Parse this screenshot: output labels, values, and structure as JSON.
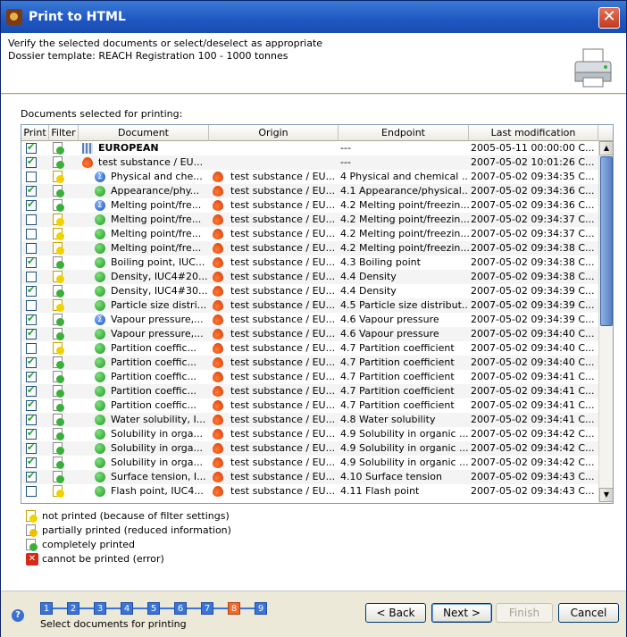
{
  "window": {
    "title": "Print to HTML"
  },
  "header": {
    "line1": "Verify the selected documents or select/deselect as appropriate",
    "line2": "Dossier template: REACH Registration 100 - 1000 tonnes"
  },
  "section_label": "Documents selected for printing:",
  "columns": [
    "Print",
    "Filter",
    "Document",
    "Origin",
    "Endpoint",
    "Last modification"
  ],
  "rows": [
    {
      "print": true,
      "filter": "complete",
      "icon": "grid",
      "document": "EUROPEAN",
      "origin": "",
      "origin_icon": false,
      "endpoint": "---",
      "modified": "2005-05-11 00:00:00 C...",
      "bold": true,
      "indent": 0
    },
    {
      "print": true,
      "filter": "complete",
      "icon": "flask",
      "document": "test substance / EU...",
      "origin": "",
      "origin_icon": false,
      "endpoint": "---",
      "modified": "2007-05-02 10:01:26 C...",
      "indent": 1
    },
    {
      "print": false,
      "filter": "notprinted",
      "icon": "sum",
      "document": "Physical and che...",
      "origin": "test substance / EU...",
      "origin_icon": true,
      "endpoint": "4 Physical and chemical ...",
      "modified": "2007-05-02 09:34:35 C...",
      "indent": 2
    },
    {
      "print": true,
      "filter": "complete",
      "icon": "green",
      "document": "Appearance/phy...",
      "origin": "test substance / EU...",
      "origin_icon": true,
      "endpoint": "4.1 Appearance/physical...",
      "modified": "2007-05-02 09:34:36 C...",
      "indent": 2
    },
    {
      "print": true,
      "filter": "complete",
      "icon": "sum",
      "document": "Melting point/fre...",
      "origin": "test substance / EU...",
      "origin_icon": true,
      "endpoint": "4.2 Melting point/freezin...",
      "modified": "2007-05-02 09:34:36 C...",
      "indent": 2
    },
    {
      "print": false,
      "filter": "notprinted",
      "icon": "green",
      "document": "Melting point/fre...",
      "origin": "test substance / EU...",
      "origin_icon": true,
      "endpoint": "4.2 Melting point/freezin...",
      "modified": "2007-05-02 09:34:37 C...",
      "indent": 2
    },
    {
      "print": false,
      "filter": "notprinted",
      "icon": "green",
      "document": "Melting point/fre...",
      "origin": "test substance / EU...",
      "origin_icon": true,
      "endpoint": "4.2 Melting point/freezin...",
      "modified": "2007-05-02 09:34:37 C...",
      "indent": 2
    },
    {
      "print": false,
      "filter": "notprinted",
      "icon": "green",
      "document": "Melting point/fre...",
      "origin": "test substance / EU...",
      "origin_icon": true,
      "endpoint": "4.2 Melting point/freezin...",
      "modified": "2007-05-02 09:34:38 C...",
      "indent": 2
    },
    {
      "print": true,
      "filter": "complete",
      "icon": "green",
      "document": "Boiling point, IUC...",
      "origin": "test substance / EU...",
      "origin_icon": true,
      "endpoint": "4.3 Boiling point",
      "modified": "2007-05-02 09:34:38 C...",
      "indent": 2
    },
    {
      "print": false,
      "filter": "notprinted",
      "icon": "green",
      "document": "Density, IUC4#20...",
      "origin": "test substance / EU...",
      "origin_icon": true,
      "endpoint": "4.4 Density",
      "modified": "2007-05-02 09:34:38 C...",
      "indent": 2
    },
    {
      "print": true,
      "filter": "complete",
      "icon": "green",
      "document": "Density, IUC4#30...",
      "origin": "test substance / EU...",
      "origin_icon": true,
      "endpoint": "4.4 Density",
      "modified": "2007-05-02 09:34:39 C...",
      "indent": 2
    },
    {
      "print": false,
      "filter": "notprinted",
      "icon": "green",
      "document": "Particle size distri...",
      "origin": "test substance / EU...",
      "origin_icon": true,
      "endpoint": "4.5 Particle size distribut...",
      "modified": "2007-05-02 09:34:39 C...",
      "indent": 2
    },
    {
      "print": true,
      "filter": "complete",
      "icon": "sum",
      "document": "Vapour pressure,...",
      "origin": "test substance / EU...",
      "origin_icon": true,
      "endpoint": "4.6 Vapour pressure",
      "modified": "2007-05-02 09:34:39 C...",
      "indent": 2
    },
    {
      "print": true,
      "filter": "complete",
      "icon": "green",
      "document": "Vapour pressure,...",
      "origin": "test substance / EU...",
      "origin_icon": true,
      "endpoint": "4.6 Vapour pressure",
      "modified": "2007-05-02 09:34:40 C...",
      "indent": 2
    },
    {
      "print": false,
      "filter": "notprinted",
      "icon": "green",
      "document": "Partition coeffic...",
      "origin": "test substance / EU...",
      "origin_icon": true,
      "endpoint": "4.7 Partition coefficient",
      "modified": "2007-05-02 09:34:40 C...",
      "indent": 2
    },
    {
      "print": true,
      "filter": "complete",
      "icon": "green",
      "document": "Partition coeffic...",
      "origin": "test substance / EU...",
      "origin_icon": true,
      "endpoint": "4.7 Partition coefficient",
      "modified": "2007-05-02 09:34:40 C...",
      "indent": 2
    },
    {
      "print": true,
      "filter": "complete",
      "icon": "green",
      "document": "Partition coeffic...",
      "origin": "test substance / EU...",
      "origin_icon": true,
      "endpoint": "4.7 Partition coefficient",
      "modified": "2007-05-02 09:34:41 C...",
      "indent": 2
    },
    {
      "print": true,
      "filter": "complete",
      "icon": "green",
      "document": "Partition coeffic...",
      "origin": "test substance / EU...",
      "origin_icon": true,
      "endpoint": "4.7 Partition coefficient",
      "modified": "2007-05-02 09:34:41 C...",
      "indent": 2
    },
    {
      "print": true,
      "filter": "complete",
      "icon": "green",
      "document": "Partition coeffic...",
      "origin": "test substance / EU...",
      "origin_icon": true,
      "endpoint": "4.7 Partition coefficient",
      "modified": "2007-05-02 09:34:41 C...",
      "indent": 2
    },
    {
      "print": true,
      "filter": "complete",
      "icon": "green",
      "document": "Water solubility, I...",
      "origin": "test substance / EU...",
      "origin_icon": true,
      "endpoint": "4.8 Water solubility",
      "modified": "2007-05-02 09:34:41 C...",
      "indent": 2
    },
    {
      "print": true,
      "filter": "complete",
      "icon": "green",
      "document": "Solubility in orga...",
      "origin": "test substance / EU...",
      "origin_icon": true,
      "endpoint": "4.9 Solubility in organic ...",
      "modified": "2007-05-02 09:34:42 C...",
      "indent": 2
    },
    {
      "print": true,
      "filter": "complete",
      "icon": "green",
      "document": "Solubility in orga...",
      "origin": "test substance / EU...",
      "origin_icon": true,
      "endpoint": "4.9 Solubility in organic ...",
      "modified": "2007-05-02 09:34:42 C...",
      "indent": 2
    },
    {
      "print": true,
      "filter": "complete",
      "icon": "green",
      "document": "Solubility in orga...",
      "origin": "test substance / EU...",
      "origin_icon": true,
      "endpoint": "4.9 Solubility in organic ...",
      "modified": "2007-05-02 09:34:42 C...",
      "indent": 2
    },
    {
      "print": true,
      "filter": "complete",
      "icon": "green",
      "document": "Surface tension, I...",
      "origin": "test substance / EU...",
      "origin_icon": true,
      "endpoint": "4.10 Surface tension",
      "modified": "2007-05-02 09:34:43 C...",
      "indent": 2
    },
    {
      "print": false,
      "filter": "notprinted",
      "icon": "green",
      "document": "Flash point, IUC4...",
      "origin": "test substance / EU...",
      "origin_icon": true,
      "endpoint": "4.11 Flash point",
      "modified": "2007-05-02 09:34:43 C...",
      "indent": 2
    }
  ],
  "legend": [
    {
      "icon": "notprinted",
      "text": "not printed (because of filter settings)"
    },
    {
      "icon": "partial",
      "text": "partially printed (reduced information)"
    },
    {
      "icon": "complete",
      "text": "completely printed"
    },
    {
      "icon": "error",
      "text": "cannot be printed (error)"
    }
  ],
  "wizard": {
    "steps": [
      "1",
      "2",
      "3",
      "4",
      "5",
      "6",
      "7",
      "8",
      "9"
    ],
    "current": 8,
    "label": "Select documents for printing"
  },
  "buttons": {
    "back": "< Back",
    "next": "Next >",
    "finish": "Finish",
    "cancel": "Cancel"
  },
  "colors": {
    "title_bar": "#1f56c2",
    "step": "#3a74d6",
    "step_current": "#ef6a2c",
    "check": "#21a121"
  }
}
